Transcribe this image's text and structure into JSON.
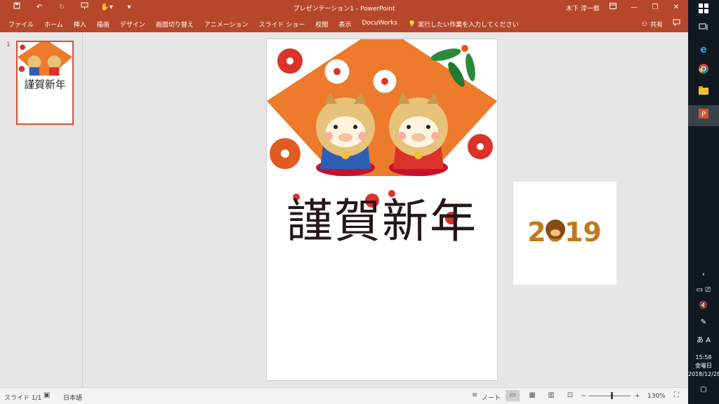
{
  "window": {
    "title": "プレゼンテーション1  -  PowerPoint",
    "user": "木下 淳一郎",
    "qat": {
      "save_icon": "save-icon",
      "undo_icon": "undo-icon",
      "redo_icon": "redo-icon",
      "present_icon": "start-slideshow-icon",
      "touch_icon": "touch-mode-icon",
      "customize_icon": "customize-qat-icon"
    },
    "controls": {
      "ribbon_display": "ribbon-display-options-icon",
      "minimize": "minimize-icon",
      "restore": "restore-icon",
      "close": "close-icon"
    }
  },
  "ribbon": {
    "tabs": [
      "ファイル",
      "ホーム",
      "挿入",
      "描画",
      "デザイン",
      "画面切り替え",
      "アニメーション",
      "スライド ショー",
      "校閲",
      "表示",
      "DocuWorks"
    ],
    "tell_me": "実行したい作業を入力してください",
    "share": "共有"
  },
  "thumbnails": [
    {
      "number": "1"
    }
  ],
  "slide": {
    "greeting": "謹賀新年",
    "offslide_year": "2019"
  },
  "statusbar": {
    "slide_count": "スライド 1/1",
    "language": "日本語",
    "notes": "ノート",
    "zoom": "130%"
  },
  "taskbar": {
    "time": "15:58",
    "day": "金曜日",
    "date": "2018/12/28",
    "ime": "あ",
    "apps": [
      "windows-start-icon",
      "task-view-icon",
      "internet-explorer-icon",
      "chrome-icon",
      "file-explorer-icon",
      "powerpoint-icon"
    ]
  },
  "colors": {
    "accent": "#b7472a",
    "fan": "#ee7a2b",
    "red": "#d9332a",
    "blue": "#2f5fb3",
    "beige": "#e6c27a"
  }
}
